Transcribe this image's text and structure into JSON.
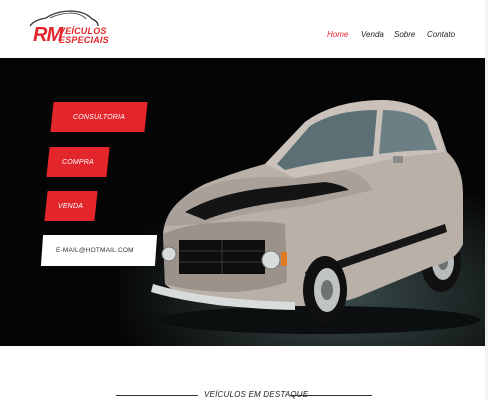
{
  "brand": {
    "initials": "RM",
    "line1": "VEÍCULOS",
    "line2": "ESPECIAIS",
    "color": "#e3262b"
  },
  "nav": {
    "items": [
      {
        "label": "Home",
        "active": true
      },
      {
        "label": "Venda",
        "active": false
      },
      {
        "label": "Sobre",
        "active": false
      },
      {
        "label": "Contato",
        "active": false
      }
    ]
  },
  "hero": {
    "buttons": [
      {
        "label": "CONSULTORIA"
      },
      {
        "label": "COMPRA"
      },
      {
        "label": "VENDA"
      }
    ],
    "email_label": "E-MAIL@HOTMAIL.COM",
    "image_icon": "classic-car-image"
  },
  "section": {
    "title": "VEÍCULOS EM DESTAQUE"
  }
}
